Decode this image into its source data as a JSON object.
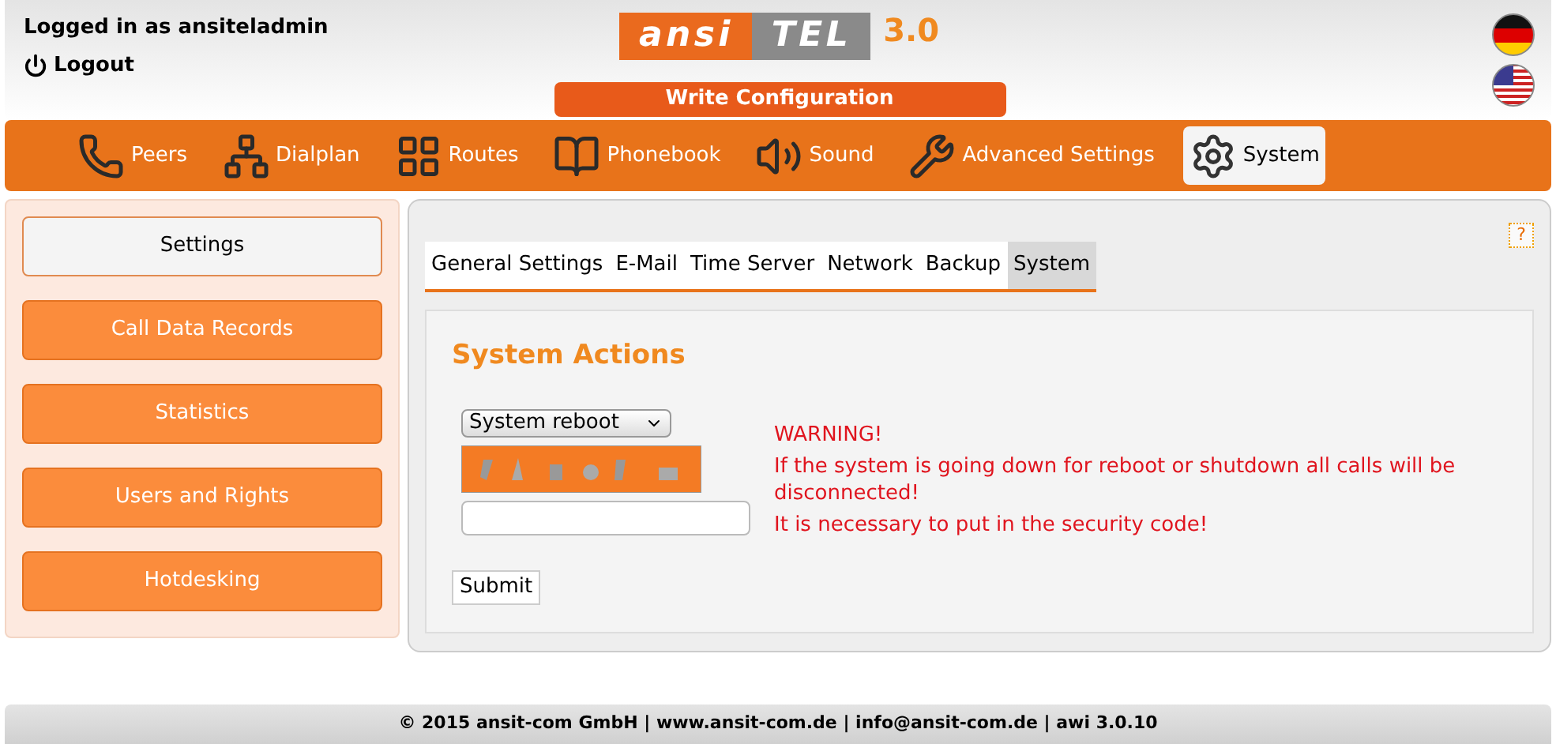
{
  "header": {
    "login_text": "Logged in as ansiteladmin",
    "logout": "Logout",
    "logo": [
      "ansi",
      "TEL",
      "3.0"
    ],
    "write_button": "Write Configuration"
  },
  "nav": [
    {
      "label": "Peers",
      "selected": false
    },
    {
      "label": "Dialplan",
      "selected": false
    },
    {
      "label": "Routes",
      "selected": false
    },
    {
      "label": "Phonebook",
      "selected": false
    },
    {
      "label": "Sound",
      "selected": false
    },
    {
      "label": "Advanced Settings",
      "selected": false
    },
    {
      "label": "System",
      "selected": true
    }
  ],
  "sidebar": {
    "items": [
      {
        "label": "Settings",
        "selected": true
      },
      {
        "label": "Call Data Records",
        "selected": false
      },
      {
        "label": "Statistics",
        "selected": false
      },
      {
        "label": "Users and Rights",
        "selected": false
      },
      {
        "label": "Hotdesking",
        "selected": false
      }
    ]
  },
  "help": "?",
  "tabs": [
    {
      "label": "General Settings",
      "selected": false
    },
    {
      "label": "E-Mail",
      "selected": false
    },
    {
      "label": "Time Server",
      "selected": false
    },
    {
      "label": "Network",
      "selected": false
    },
    {
      "label": "Backup",
      "selected": false
    },
    {
      "label": "System",
      "selected": true
    }
  ],
  "section": {
    "title": "System Actions",
    "action_select": "System reboot",
    "messages": [
      "WARNING!",
      "If the system is going down for reboot or shutdown all calls will be disconnected!",
      "It is necessary to put in the security code!"
    ],
    "submit": "Submit"
  },
  "footer": "© 2015 ansit-com GmbH | www.ansit-com.de | info@ansit-com.de | awi 3.0.10"
}
